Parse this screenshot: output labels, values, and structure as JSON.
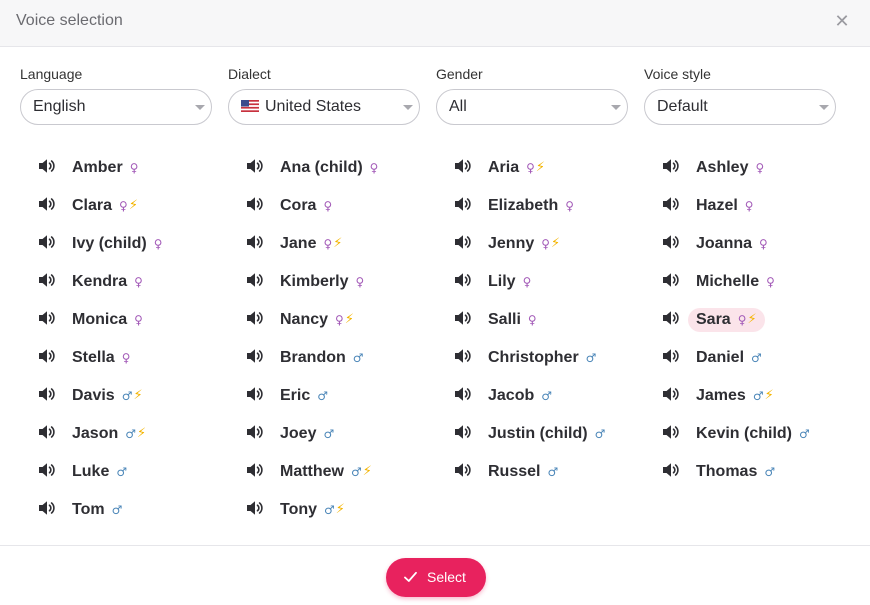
{
  "header": {
    "title": "Voice selection",
    "close_glyph": "✕"
  },
  "filters": {
    "language": {
      "label": "Language",
      "value": "English"
    },
    "dialect": {
      "label": "Dialect",
      "value": "United States",
      "flag_icon": "us-flag-icon"
    },
    "gender": {
      "label": "Gender",
      "value": "All"
    },
    "voice_style": {
      "label": "Voice style",
      "value": "Default"
    }
  },
  "symbols": {
    "female": "♀",
    "male": "♂",
    "neural": "⚡"
  },
  "voices": {
    "col1": [
      {
        "name": "Amber",
        "gender": "female",
        "neural": false
      },
      {
        "name": "Clara",
        "gender": "female",
        "neural": true
      },
      {
        "name": "Ivy (child)",
        "gender": "female",
        "neural": false
      },
      {
        "name": "Kendra",
        "gender": "female",
        "neural": false
      },
      {
        "name": "Monica",
        "gender": "female",
        "neural": false
      },
      {
        "name": "Stella",
        "gender": "female",
        "neural": false
      },
      {
        "name": "Davis",
        "gender": "male",
        "neural": true
      },
      {
        "name": "Jason",
        "gender": "male",
        "neural": true
      },
      {
        "name": "Luke",
        "gender": "male",
        "neural": false
      },
      {
        "name": "Tom",
        "gender": "male",
        "neural": false
      }
    ],
    "col2": [
      {
        "name": "Ana (child)",
        "gender": "female",
        "neural": false
      },
      {
        "name": "Cora",
        "gender": "female",
        "neural": false
      },
      {
        "name": "Jane",
        "gender": "female",
        "neural": true
      },
      {
        "name": "Kimberly",
        "gender": "female",
        "neural": false
      },
      {
        "name": "Nancy",
        "gender": "female",
        "neural": true
      },
      {
        "name": "Brandon",
        "gender": "male",
        "neural": false
      },
      {
        "name": "Eric",
        "gender": "male",
        "neural": false
      },
      {
        "name": "Joey",
        "gender": "male",
        "neural": false
      },
      {
        "name": "Matthew",
        "gender": "male",
        "neural": true
      },
      {
        "name": "Tony",
        "gender": "male",
        "neural": true
      }
    ],
    "col3": [
      {
        "name": "Aria",
        "gender": "female",
        "neural": true
      },
      {
        "name": "Elizabeth",
        "gender": "female",
        "neural": false
      },
      {
        "name": "Jenny",
        "gender": "female",
        "neural": true
      },
      {
        "name": "Lily",
        "gender": "female",
        "neural": false
      },
      {
        "name": "Salli",
        "gender": "female",
        "neural": false
      },
      {
        "name": "Christopher",
        "gender": "male",
        "neural": false
      },
      {
        "name": "Jacob",
        "gender": "male",
        "neural": false
      },
      {
        "name": "Justin (child)",
        "gender": "male",
        "neural": false
      },
      {
        "name": "Russel",
        "gender": "male",
        "neural": false
      }
    ],
    "col4": [
      {
        "name": "Ashley",
        "gender": "female",
        "neural": false
      },
      {
        "name": "Hazel",
        "gender": "female",
        "neural": false
      },
      {
        "name": "Joanna",
        "gender": "female",
        "neural": false
      },
      {
        "name": "Michelle",
        "gender": "female",
        "neural": false
      },
      {
        "name": "Sara",
        "gender": "female",
        "neural": true,
        "selected": true
      },
      {
        "name": "Daniel",
        "gender": "male",
        "neural": false
      },
      {
        "name": "James",
        "gender": "male",
        "neural": true
      },
      {
        "name": "Kevin (child)",
        "gender": "male",
        "neural": false
      },
      {
        "name": "Thomas",
        "gender": "male",
        "neural": false
      }
    ]
  },
  "footer": {
    "select_label": "Select"
  },
  "colors": {
    "accent": "#e8225e",
    "selected_bg": "#fbe4ea",
    "female": "#a35bb8",
    "male": "#4b86b8",
    "neural": "#f3b400"
  }
}
